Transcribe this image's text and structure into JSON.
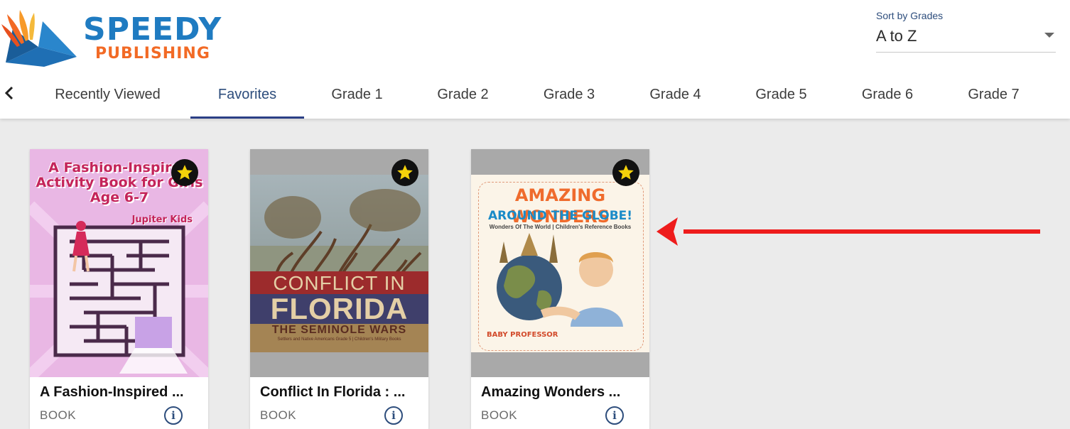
{
  "brand": {
    "line1": "SPEEDY",
    "line2": "PUBLISHING"
  },
  "sort": {
    "label": "Sort by Grades",
    "value": "A to Z"
  },
  "tabs": [
    {
      "label": "Recently Viewed",
      "active": false
    },
    {
      "label": "Favorites",
      "active": true
    },
    {
      "label": "Grade 1",
      "active": false
    },
    {
      "label": "Grade 2",
      "active": false
    },
    {
      "label": "Grade 3",
      "active": false
    },
    {
      "label": "Grade 4",
      "active": false
    },
    {
      "label": "Grade 5",
      "active": false
    },
    {
      "label": "Grade 6",
      "active": false
    },
    {
      "label": "Grade 7",
      "active": false
    }
  ],
  "cards": [
    {
      "title": "A Fashion-Inspired ...",
      "type": "BOOK",
      "favorited": true,
      "cover": {
        "text1": "A Fashion-Inspired Activity Book for Girls Age 6-7",
        "text2": "Jupiter Kids"
      }
    },
    {
      "title": "Conflict In Florida : ...",
      "type": "BOOK",
      "favorited": true,
      "cover": {
        "text1": "CONFLICT IN",
        "text2": "FLORIDA",
        "text3": "THE SEMINOLE WARS",
        "text4": "Settlers and Native Americans Grade 5 | Children's Military Books"
      }
    },
    {
      "title": "Amazing Wonders ...",
      "type": "BOOK",
      "favorited": true,
      "cover": {
        "text1": "AMAZING WONDERS",
        "text2": "AROUND THE GLOBE!",
        "text3": "Wonders Of The World | Children's Reference Books",
        "text4": "BABY PROFESSOR"
      }
    }
  ],
  "colors": {
    "accent": "#2b3f86",
    "brand_blue": "#1f7bc1",
    "brand_orange": "#f26a25",
    "arrow": "#ee1c1c",
    "star": "#f5d20a"
  },
  "icons": {
    "back": "chevron-left-icon",
    "star": "star-icon",
    "info": "info-icon",
    "caret": "caret-down-icon"
  }
}
